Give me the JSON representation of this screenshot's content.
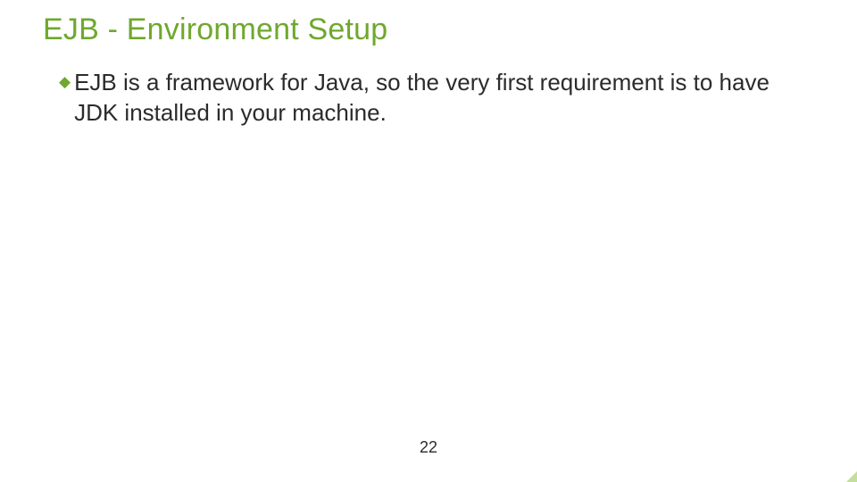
{
  "title": "EJB - Environment Setup",
  "bullet": {
    "text": "EJB is a framework for Java, so the very first requirement is to have JDK installed in your machine."
  },
  "page_number": "22"
}
